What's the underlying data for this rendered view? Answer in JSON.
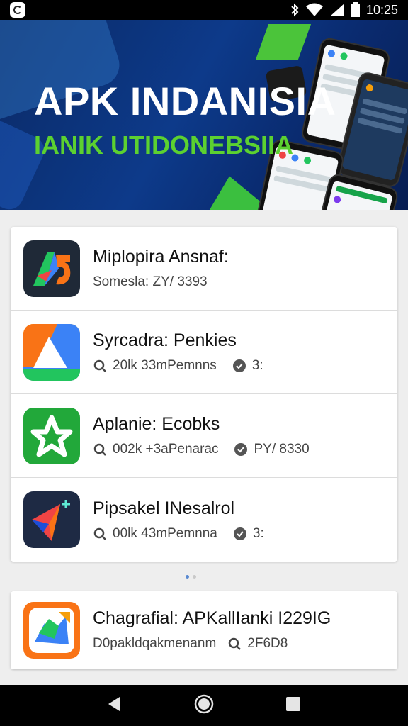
{
  "status_bar": {
    "time": "10:25",
    "icons": [
      "app-notification-icon",
      "bluetooth-icon",
      "wifi-icon",
      "signal-icon",
      "battery-icon"
    ]
  },
  "banner": {
    "title": "APK INDANISIA",
    "subtitle": "IANIK UTIDONEBSIIA",
    "colors": {
      "background": "#0d3a8a",
      "accent_green": "#5cd130"
    }
  },
  "apps": [
    {
      "name": "Miplopira Ansnaf:",
      "meta_text": "Somesla: ZY/ 3393",
      "meta_extra": "",
      "icon": "stylized-a-icon"
    },
    {
      "name": "Syrcadra: Penkies",
      "meta_text": "20lk 33mPemnns",
      "meta_extra": "3:",
      "icon": "triangle-drive-icon"
    },
    {
      "name": "Aplanie: Ecobks",
      "meta_text": "002k +3aPenarac",
      "meta_extra": "PY/ 8330",
      "icon": "green-star-icon"
    },
    {
      "name": "Pipsakel INesalrol",
      "meta_text": "00lk 43mPemnna",
      "meta_extra": "3:",
      "icon": "paper-plane-icon"
    }
  ],
  "pager": {
    "pages": 2,
    "current": 1
  },
  "featured_app": {
    "name": "Chagrafial: APKallIanki I229IG",
    "meta_text": "D0pakldqakmenanm",
    "meta_extra": "2F6D8",
    "icon": "orange-map-icon"
  },
  "nav_bar": {
    "buttons": [
      "back-icon",
      "home-icon",
      "recents-icon"
    ]
  }
}
